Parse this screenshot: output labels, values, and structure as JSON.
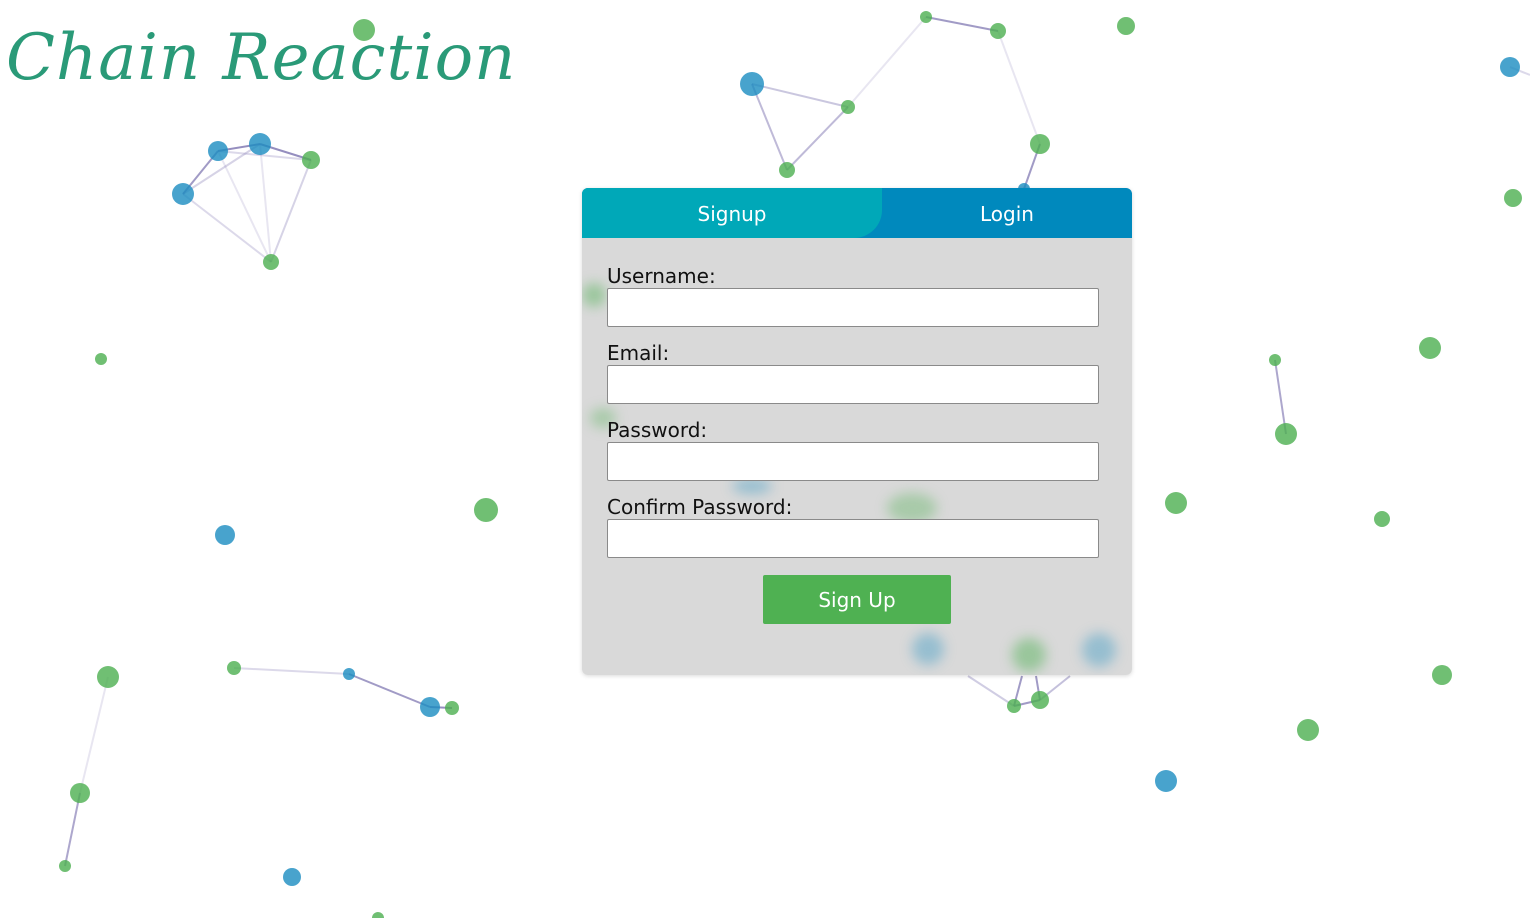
{
  "app": {
    "title": "Chain Reaction"
  },
  "tabs": [
    {
      "label": "Signup",
      "active": true
    },
    {
      "label": "Login",
      "active": false
    }
  ],
  "form": {
    "fields": [
      {
        "label": "Username:",
        "value": "",
        "placeholder": ""
      },
      {
        "label": "Email:",
        "value": "",
        "placeholder": ""
      },
      {
        "label": "Password:",
        "value": "",
        "placeholder": ""
      },
      {
        "label": "Confirm Password:",
        "value": "",
        "placeholder": ""
      }
    ],
    "submit_label": "Sign Up"
  },
  "colors": {
    "title": "#2a9a78",
    "tab_active": "#00a8b8",
    "tab_inactive": "#0089bd",
    "panel": "#d6d6d6",
    "submit": "#4fb152",
    "node_green": "#4caf50",
    "node_blue": "#1a8cc0",
    "edge": "#8a82b8"
  }
}
